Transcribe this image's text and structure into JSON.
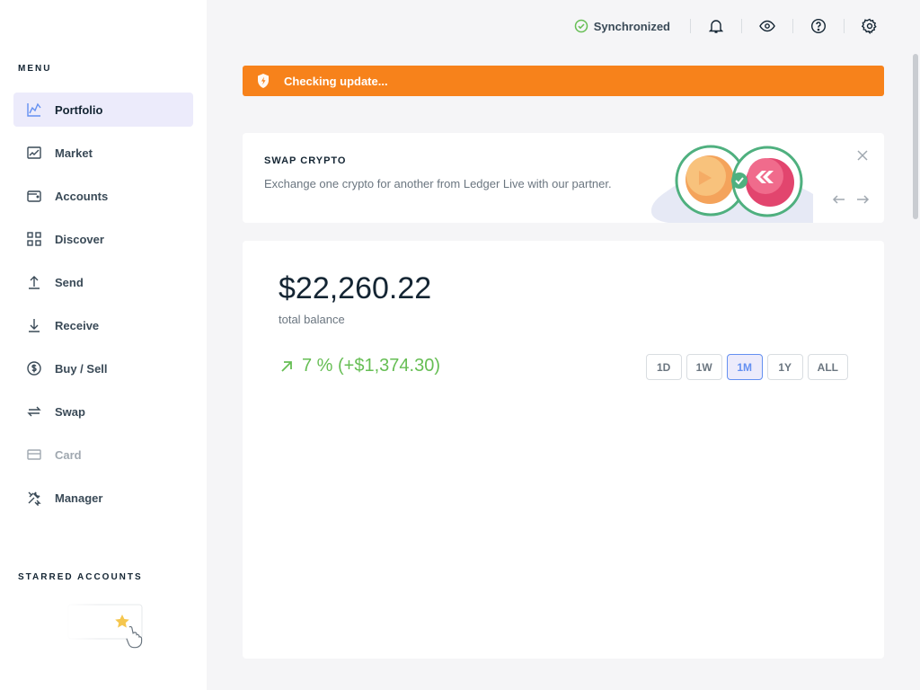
{
  "sidebar": {
    "menu_title": "MENU",
    "items": [
      {
        "label": "Portfolio",
        "icon": "chart-line-icon",
        "active": true
      },
      {
        "label": "Market",
        "icon": "market-chart-icon"
      },
      {
        "label": "Accounts",
        "icon": "wallet-icon"
      },
      {
        "label": "Discover",
        "icon": "grid-icon"
      },
      {
        "label": "Send",
        "icon": "arrow-up-icon"
      },
      {
        "label": "Receive",
        "icon": "arrow-down-icon"
      },
      {
        "label": "Buy / Sell",
        "icon": "dollar-circle-icon"
      },
      {
        "label": "Swap",
        "icon": "swap-arrows-icon"
      },
      {
        "label": "Card",
        "icon": "card-icon",
        "disabled": true
      },
      {
        "label": "Manager",
        "icon": "tools-icon"
      }
    ],
    "starred_title": "STARRED ACCOUNTS"
  },
  "topbar": {
    "sync_label": "Synchronized"
  },
  "update_banner": {
    "text": "Checking update..."
  },
  "swap_card": {
    "title": "SWAP CRYPTO",
    "description": "Exchange one crypto for another from Ledger Live with our partner."
  },
  "portfolio": {
    "balance": "$22,260.22",
    "balance_label": "total balance",
    "delta": "7 % (+$1,374.30)",
    "ranges": [
      "1D",
      "1W",
      "1M",
      "1Y",
      "ALL"
    ],
    "selected_range": "1M"
  },
  "colors": {
    "accent": "#6490f1",
    "warning": "#f7821b",
    "success": "#66be54"
  }
}
